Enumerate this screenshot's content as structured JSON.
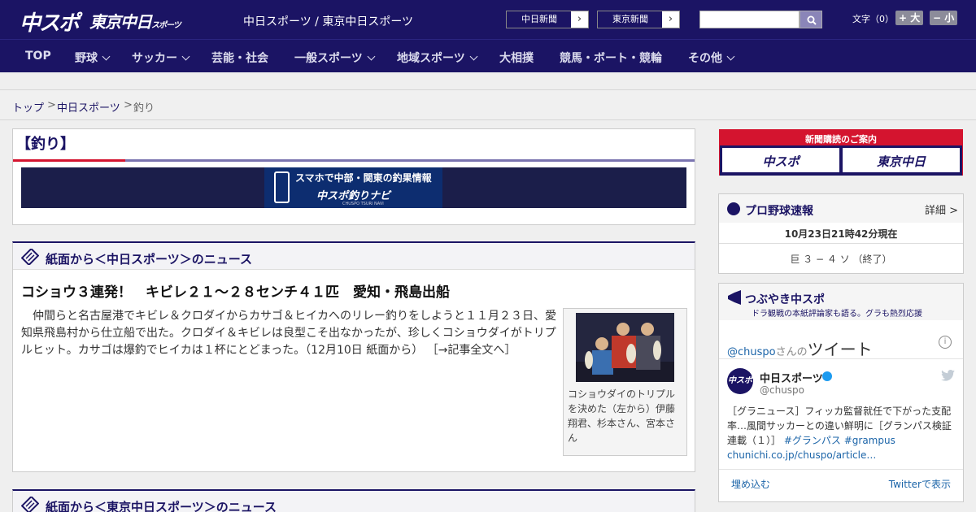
{
  "header": {
    "logo_primary": "中スポ",
    "logo_secondary": "東京中日",
    "logo_secondary_small": "スポーツ",
    "site_title": "中日スポーツ / 東京中日スポーツ",
    "ext_links": [
      {
        "label": "中日新聞",
        "arrow": "›"
      },
      {
        "label": "東京新聞",
        "arrow": "›"
      }
    ],
    "search_placeholder": "",
    "font_size_label": "文字（0）",
    "font_larger": "+ 大",
    "font_smaller": "− 小"
  },
  "nav": {
    "items": [
      {
        "label": "TOP",
        "has_menu": false
      },
      {
        "label": "野球",
        "has_menu": true
      },
      {
        "label": "サッカー",
        "has_menu": true
      },
      {
        "label": "芸能・社会",
        "has_menu": false
      },
      {
        "label": "一般スポーツ",
        "has_menu": true
      },
      {
        "label": "地域スポーツ",
        "has_menu": true
      },
      {
        "label": "大相撲",
        "has_menu": false
      },
      {
        "label": "競馬・ボート・競輪",
        "has_menu": false
      },
      {
        "label": "その他",
        "has_menu": true
      }
    ]
  },
  "breadcrumb": {
    "items": [
      "トップ",
      "中日スポーツ",
      "釣り"
    ],
    "separator": ">"
  },
  "category": {
    "title": "【釣り】",
    "banner_line1": "スマホで中部・関東の釣果情報",
    "banner_line2": "中スポ釣りナビ",
    "banner_line3": "CHUSPO TSURI NAVI"
  },
  "news_chunichi": {
    "section_title": "紙面から＜中日スポーツ＞のニュース",
    "article_title": "コショウ３連発！　キビレ２１～２８センチ４１匹　愛知・飛島出船",
    "article_body": "　仲間らと名古屋港でキビレ＆クロダイからカサゴ＆ヒイカへのリレー釣りをしようと１１月２３日、愛知県飛島村から仕立船で出た。クロダイ＆キビレは良型こそ出なかったが、珍しくコショウダイがトリプルヒット。カサゴは爆釣でヒイカは１杯にとどまった。（12月10日 紙面から）",
    "article_more": "［→記事全文へ］",
    "photo_caption": "コショウダイのトリプルを決めた（左から）伊藤翔君、杉本さん、宮本さん"
  },
  "news_tokyo": {
    "section_title": "紙面から＜東京中日スポーツ＞のニュース"
  },
  "subscription": {
    "title": "新聞購読のご案内",
    "button_left": "中スポ",
    "button_right": "東京中日"
  },
  "baseball": {
    "title": "プロ野球速報",
    "more": "詳細 >",
    "timestamp": "10月23日21時42分現在",
    "score": "巨 ３ − ４ ソ （終了）"
  },
  "tweets": {
    "title": "つぶやき中スポ",
    "subtitle": "ドラ観戦の本紙評論家も語る。グラも熱烈応援",
    "handle_prefix": "@chuspo",
    "handle_suffix": "さんの",
    "heading": "ツイート",
    "tweet": {
      "name": "中日スポーツ",
      "handle": "@chuspo",
      "avatar": "中スポ",
      "text": "［グラニュース］フィッカ監督就任で下がった支配率…風間サッカーとの違い鮮明に［グランパス検証連載（１）］",
      "tags": "#グランパス #grampus",
      "link": "chunichi.co.jp/chuspo/article…"
    },
    "embed": "埋め込む",
    "view": "Twitterで表示"
  },
  "colors": {
    "navy": "#1b1464",
    "accent_red": "#d4142f",
    "link_blue": "#1b64a8"
  }
}
